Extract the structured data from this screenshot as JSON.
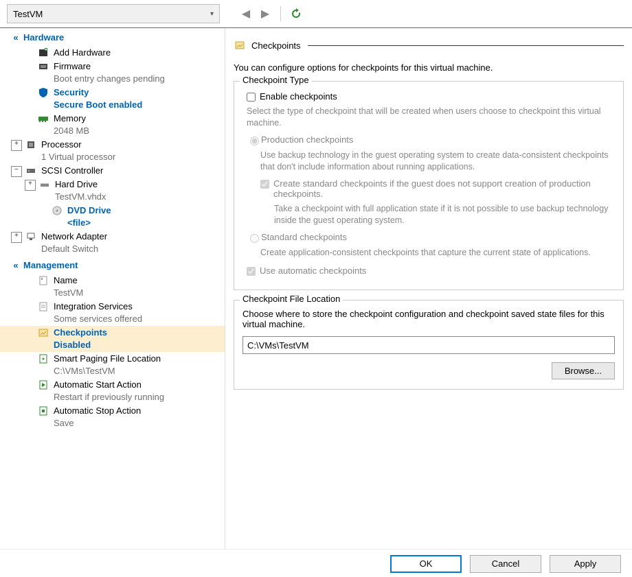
{
  "top": {
    "vm_name": "TestVM"
  },
  "nav": {
    "hardware_cat": "Hardware",
    "management_cat": "Management",
    "items": {
      "add_hw": {
        "title": "Add Hardware"
      },
      "firmware": {
        "title": "Firmware",
        "sub": "Boot entry changes pending"
      },
      "security": {
        "title": "Security",
        "sub": "Secure Boot enabled"
      },
      "memory": {
        "title": "Memory",
        "sub": "2048 MB"
      },
      "processor": {
        "title": "Processor",
        "sub": "1 Virtual processor"
      },
      "scsi": {
        "title": "SCSI Controller"
      },
      "hard_drive": {
        "title": "Hard Drive",
        "sub": "TestVM.vhdx"
      },
      "dvd": {
        "title": "DVD Drive",
        "sub": "<file>"
      },
      "net": {
        "title": "Network Adapter",
        "sub": "Default Switch"
      },
      "name": {
        "title": "Name",
        "sub": "TestVM"
      },
      "integ": {
        "title": "Integration Services",
        "sub": "Some services offered"
      },
      "check": {
        "title": "Checkpoints",
        "sub": "Disabled"
      },
      "smart": {
        "title": "Smart Paging File Location",
        "sub": "C:\\VMs\\TestVM"
      },
      "autostart": {
        "title": "Automatic Start Action",
        "sub": "Restart if previously running"
      },
      "autostop": {
        "title": "Automatic Stop Action",
        "sub": "Save"
      }
    }
  },
  "right": {
    "panel_title": "Checkpoints",
    "intro": "You can configure options for checkpoints for this virtual machine.",
    "type_section": "Checkpoint Type",
    "enable_label": "Enable checkpoints",
    "type_desc": "Select the type of checkpoint that will be created when users choose to checkpoint this virtual machine.",
    "prod_label": "Production checkpoints",
    "prod_desc": "Use backup technology in the guest operating system to create data-consistent checkpoints that don't include information about running applications.",
    "fallback_label": "Create standard checkpoints if the guest does not support creation of production checkpoints.",
    "fallback_desc": "Take a checkpoint with full application state if it is not possible to use backup technology inside the guest operating system.",
    "std_label": "Standard checkpoints",
    "std_desc": "Create application-consistent checkpoints that capture the current state of applications.",
    "auto_label": "Use automatic checkpoints",
    "loc_section": "Checkpoint File Location",
    "loc_desc": "Choose where to store the checkpoint configuration and checkpoint saved state files for this virtual machine.",
    "loc_value": "C:\\VMs\\TestVM",
    "browse": "Browse..."
  },
  "buttons": {
    "ok": "OK",
    "cancel": "Cancel",
    "apply": "Apply"
  }
}
